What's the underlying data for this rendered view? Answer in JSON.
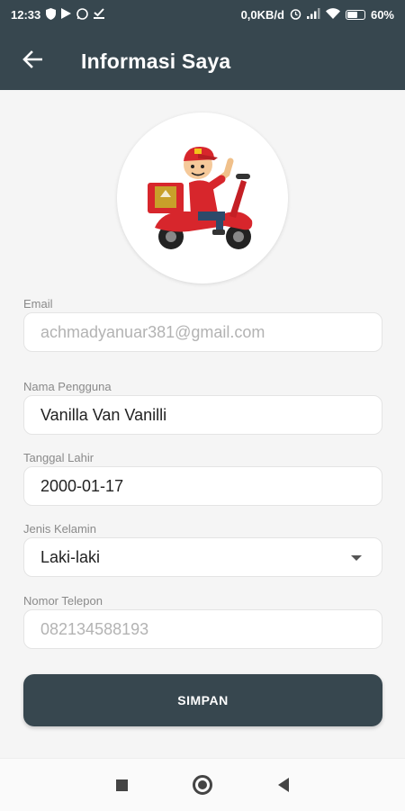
{
  "status_bar": {
    "time": "12:33",
    "network_speed": "0,0KB/d",
    "battery_level": "60%"
  },
  "toolbar": {
    "title": "Informasi Saya",
    "back_icon": "arrow-left-icon"
  },
  "form": {
    "email": {
      "label": "Email",
      "value": "achmadyanuar381@gmail.com"
    },
    "username": {
      "label": "Nama Pengguna",
      "value": "Vanilla Van Vanilli"
    },
    "birth_date": {
      "label": "Tanggal Lahir",
      "value": "2000-01-17"
    },
    "gender": {
      "label": "Jenis Kelamin",
      "value": "Laki-laki"
    },
    "phone": {
      "label": "Nomor Telepon",
      "value": "082134588193"
    },
    "save_label": "SIMPAN"
  },
  "navigation": {
    "recents_icon": "square-icon",
    "home_icon": "circle-icon",
    "back_icon": "triangle-back-icon"
  },
  "colors": {
    "primary": "#37474f",
    "background": "#f5f5f5"
  }
}
